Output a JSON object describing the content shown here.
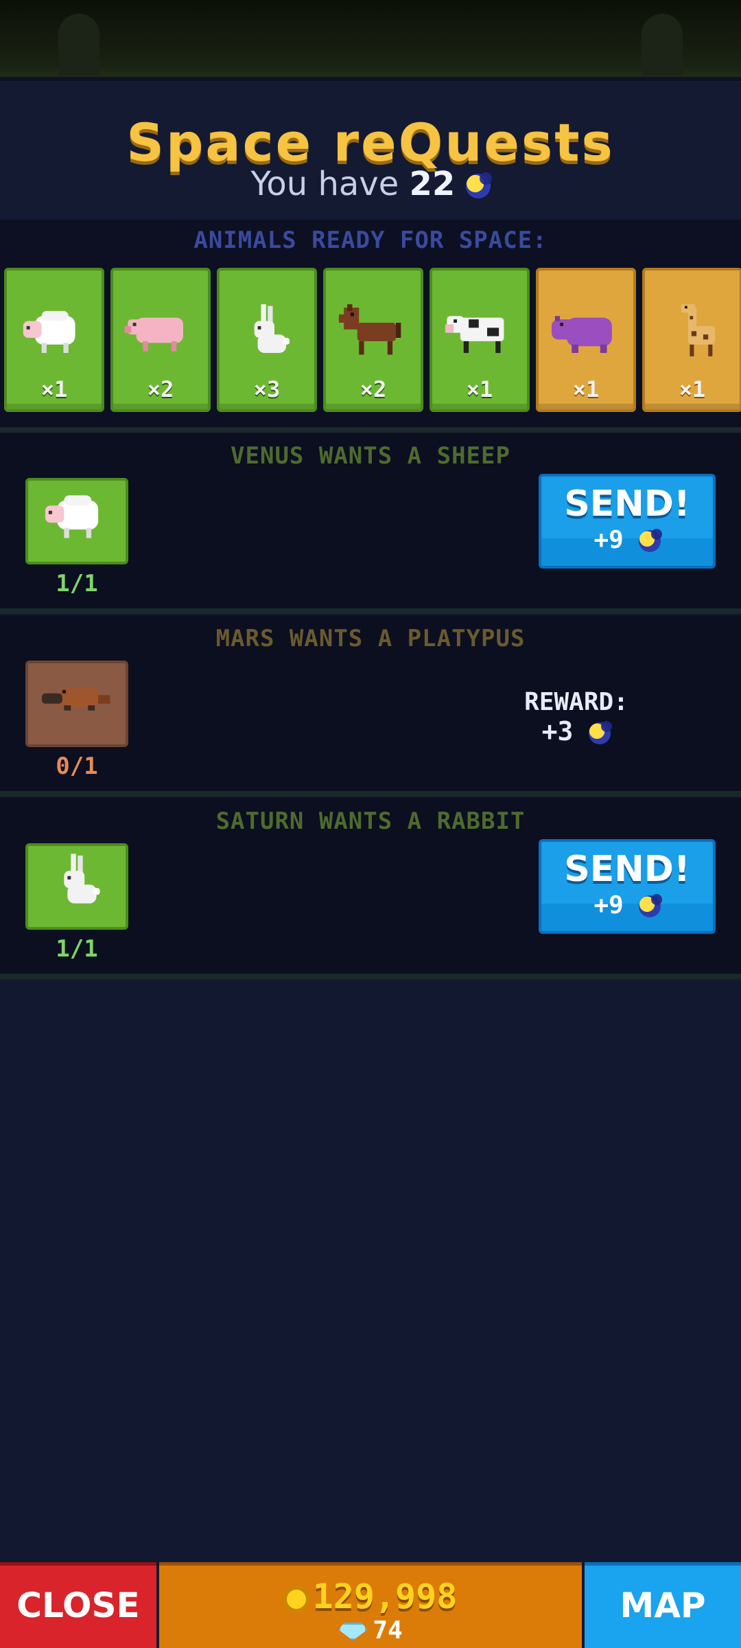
{
  "header": {
    "title": "Space reQuests",
    "have_prefix": "You have",
    "have_count": "22",
    "currency_icon": "moon-coin-icon"
  },
  "ready": {
    "label": "ANIMALS READY FOR SPACE:",
    "animals": [
      {
        "name": "sheep",
        "count": "×1",
        "card": "green"
      },
      {
        "name": "pig",
        "count": "×2",
        "card": "green"
      },
      {
        "name": "rabbit",
        "count": "×3",
        "card": "green"
      },
      {
        "name": "horse",
        "count": "×2",
        "card": "green"
      },
      {
        "name": "cow",
        "count": "×1",
        "card": "green"
      },
      {
        "name": "hippo",
        "count": "×1",
        "card": "gold"
      },
      {
        "name": "giraffe",
        "count": "×1",
        "card": "gold"
      }
    ]
  },
  "quests": [
    {
      "title": "VENUS WANTS A SHEEP",
      "title_color": "#4f6a2e",
      "animal": "sheep",
      "progress": "1/1",
      "progress_color": "#7fd46a",
      "action": "send",
      "button_label": "SEND!",
      "reward": "+9"
    },
    {
      "title": "MARS WANTS A PLATYPUS",
      "title_color": "#6a5a2e",
      "animal": "platypus",
      "progress": "0/1",
      "progress_color": "#e88a5a",
      "action": "reward",
      "reward_label": "REWARD:",
      "reward": "+3"
    },
    {
      "title": "SATURN WANTS A RABBIT",
      "title_color": "#4f6a2e",
      "animal": "rabbit",
      "progress": "1/1",
      "progress_color": "#7fd46a",
      "action": "send",
      "button_label": "SEND!",
      "reward": "+9"
    }
  ],
  "footer": {
    "close_label": "CLOSE",
    "coins": "129,998",
    "gems": "74",
    "map_label": "MAP"
  },
  "colors": {
    "title": "#f6c342",
    "send_button": "#1a9fe8",
    "close_button": "#d8242a",
    "map_button": "#1aa3ee",
    "money_bar": "#dc7c08"
  }
}
